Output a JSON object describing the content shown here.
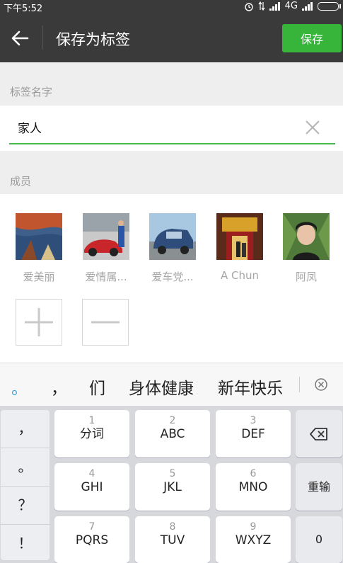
{
  "status_bar": {
    "time": "下午5:52",
    "network": "4G"
  },
  "header": {
    "title": "保存为标签",
    "save_label": "保存"
  },
  "tag_name": {
    "section_label": "标签名字",
    "value": "家人"
  },
  "members": {
    "section_label": "成员",
    "items": [
      {
        "name": "爱美丽"
      },
      {
        "name": "爱情属..."
      },
      {
        "name": "爱车党..."
      },
      {
        "name": "A Chun"
      },
      {
        "name": "阿凤"
      }
    ]
  },
  "candidates": [
    "。",
    "，",
    "们",
    "身体健康",
    "新年快乐"
  ],
  "keyboard": {
    "punctuation": [
      "，",
      "。",
      "？",
      "！"
    ],
    "keys": [
      {
        "num": "1",
        "letters": "分词"
      },
      {
        "num": "2",
        "letters": "ABC"
      },
      {
        "num": "3",
        "letters": "DEF"
      },
      {
        "num": "4",
        "letters": "GHI"
      },
      {
        "num": "5",
        "letters": "JKL"
      },
      {
        "num": "6",
        "letters": "MNO"
      },
      {
        "num": "7",
        "letters": "PQRS"
      },
      {
        "num": "8",
        "letters": "TUV"
      },
      {
        "num": "9",
        "letters": "WXYZ"
      }
    ],
    "retype_label": "重输",
    "zero_label": "0"
  },
  "colors": {
    "accent_green": "#36b53a",
    "header_bg": "#3a3a3a"
  }
}
